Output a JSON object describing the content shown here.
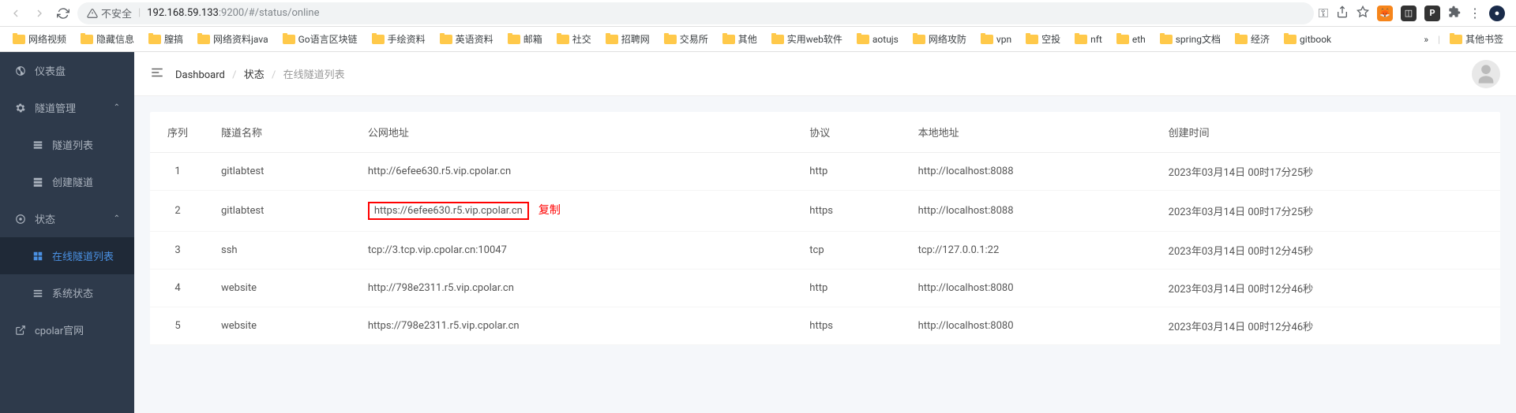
{
  "browser": {
    "url_insecure_label": "不安全",
    "url_host": "192.168.59.133",
    "url_port": ":9200",
    "url_path": "/#/status/online"
  },
  "bookmarks": [
    "网络视频",
    "隐藏信息",
    "膣搞",
    "网络资料java",
    "Go语言区块链",
    "手绘资料",
    "英语资料",
    "邮箱",
    "社交",
    "招聘网",
    "交易所",
    "其他",
    "实用web软件",
    "aotujs",
    "网络攻防",
    "vpn",
    "空投",
    "nft",
    "eth",
    "spring文档",
    "经济",
    "gitbook"
  ],
  "bookmarks_more": "»",
  "bookmarks_other": "其他书签",
  "sidebar": {
    "dashboard": "仪表盘",
    "tunnel_mgmt": "隧道管理",
    "tunnel_list": "隧道列表",
    "create_tunnel": "创建隧道",
    "status": "状态",
    "online_list": "在线隧道列表",
    "system_status": "系统状态",
    "cpolar_official": "cpolar官网"
  },
  "breadcrumb": {
    "dashboard": "Dashboard",
    "status": "状态",
    "online_list": "在线隧道列表"
  },
  "table": {
    "headers": {
      "index": "序列",
      "name": "隧道名称",
      "public_addr": "公网地址",
      "protocol": "协议",
      "local_addr": "本地地址",
      "created": "创建时间"
    },
    "rows": [
      {
        "index": "1",
        "name": "gitlabtest",
        "public": "http://6efee630.r5.vip.cpolar.cn",
        "proto": "http",
        "local": "http://localhost:8088",
        "created": "2023年03月14日 00时17分25秒",
        "highlight": false
      },
      {
        "index": "2",
        "name": "gitlabtest",
        "public": "https://6efee630.r5.vip.cpolar.cn",
        "proto": "https",
        "local": "http://localhost:8088",
        "created": "2023年03月14日 00时17分25秒",
        "highlight": true
      },
      {
        "index": "3",
        "name": "ssh",
        "public": "tcp://3.tcp.vip.cpolar.cn:10047",
        "proto": "tcp",
        "local": "tcp://127.0.0.1:22",
        "created": "2023年03月14日 00时12分45秒",
        "highlight": false
      },
      {
        "index": "4",
        "name": "website",
        "public": "http://798e2311.r5.vip.cpolar.cn",
        "proto": "http",
        "local": "http://localhost:8080",
        "created": "2023年03月14日 00时12分46秒",
        "highlight": false
      },
      {
        "index": "5",
        "name": "website",
        "public": "https://798e2311.r5.vip.cpolar.cn",
        "proto": "https",
        "local": "http://localhost:8080",
        "created": "2023年03月14日 00时12分46秒",
        "highlight": false
      }
    ]
  },
  "copy_label": "复制"
}
